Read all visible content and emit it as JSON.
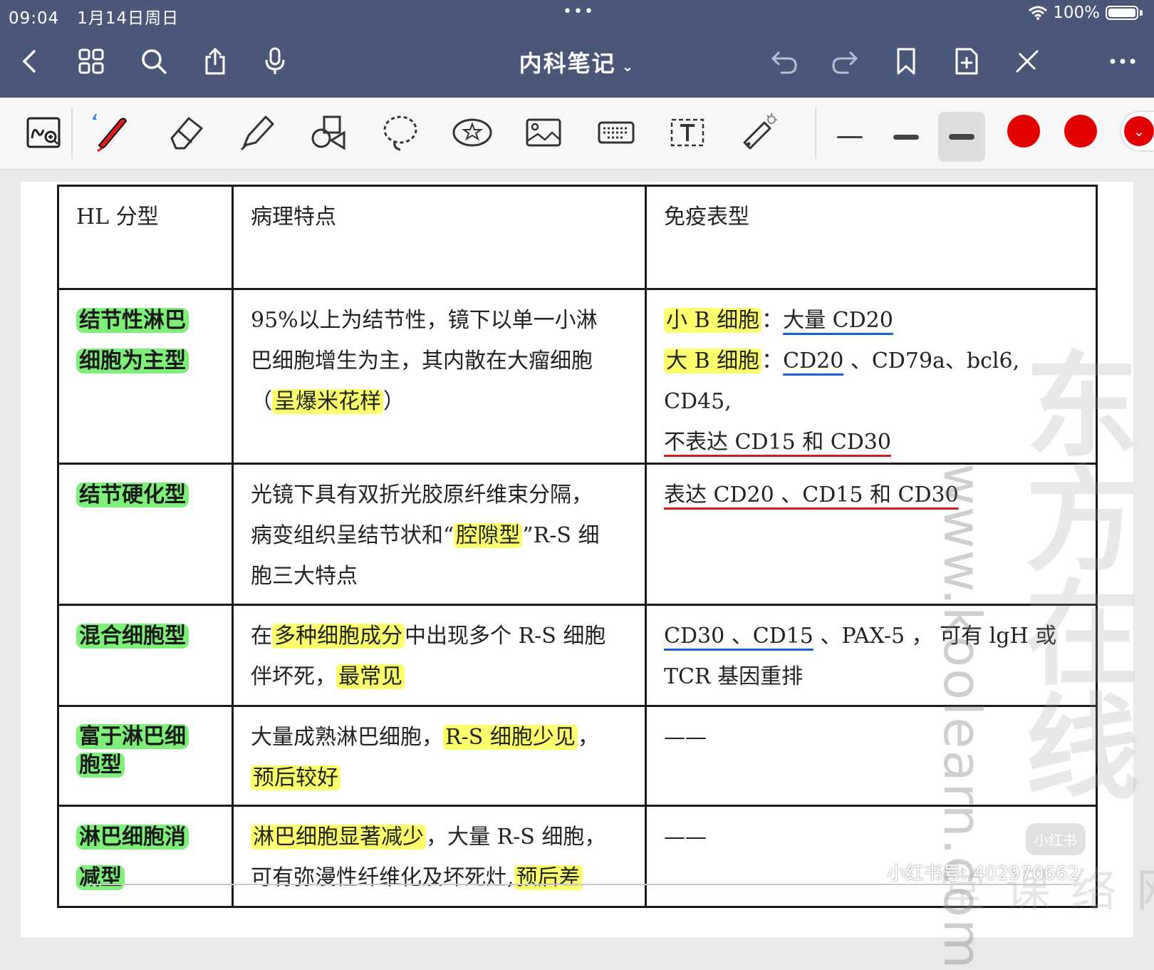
{
  "status": {
    "time": "09:04",
    "date": "1月14日周日",
    "battery": "100%"
  },
  "nav": {
    "title": "内科笔记",
    "caret": "⌄"
  },
  "toolbar": {
    "tools": [
      "zoom-write-icon",
      "pen-icon",
      "eraser-icon",
      "highlighter-icon",
      "shapes-icon",
      "lasso-icon",
      "sticker-icon",
      "image-icon",
      "keyboard-icon",
      "text-box-icon",
      "laser-pointer-icon"
    ],
    "color": "#e30000"
  },
  "table": {
    "headers": [
      "HL 分型",
      "病理特点",
      "免疫表型"
    ],
    "rows": [
      {
        "type_a": "结节性淋巴",
        "type_b": "细胞为主型",
        "path_1": "95%以上为结节性，镜下以单一小淋",
        "path_2": "巴细胞增生为主，其内散在大瘤细胞",
        "path_3_pre": "（",
        "path_3_hl": "呈爆米花样",
        "path_3_post": "）",
        "imm_1_hl": "小 B 细胞",
        "imm_1_colon": "：",
        "imm_1_ul": "大量 CD20",
        "imm_2_hl": "大 B 细胞",
        "imm_2_colon": "：",
        "imm_2_ul": "CD20",
        "imm_2_rest": " 、CD79a、bcl6, CD45,",
        "imm_3_ul": "不表达 CD15 和 CD30"
      },
      {
        "type_a": "结节硬化型",
        "path_1": "光镜下具有双折光胶原纤维束分隔，",
        "path_2_pre": "病变组织呈结节状和“",
        "path_2_hl": "腔隙型",
        "path_2_post": "”R-S 细",
        "path_3": "胞三大特点",
        "imm_1_ul": "表达 CD20 、CD15 和 CD30"
      },
      {
        "type_a": "混合细胞型",
        "path_1_pre": "在",
        "path_1_hl": "多种细胞成分",
        "path_1_post": "中出现多个 R-S 细胞",
        "path_2_pre": "伴坏死，",
        "path_2_hl": "最常见",
        "imm_1_ul": "CD30 、CD15",
        "imm_1_rest": " 、PAX-5 ， 可有 lgH 或",
        "imm_2": "TCR 基因重排"
      },
      {
        "type_a": "富于淋巴细",
        "type_b": "胞型",
        "path_1_pre": "大量成熟淋巴细胞，",
        "path_1_hl": "R-S 细胞少见",
        "path_1_post": "，",
        "path_2_hl": "预后较好",
        "imm_1": "——"
      },
      {
        "type_a": "淋巴细胞消",
        "type_b": "减型",
        "path_1_hl": "淋巴细胞显著减少",
        "path_1_post": "，大量 R-S 细胞，",
        "path_2_pre": "可有弥漫性纤维化及坏死灶,",
        "path_2_hl": "预后差",
        "imm_1": "——"
      }
    ]
  },
  "watermarks": {
    "site": "www.koolearn.com",
    "big": "东方在线",
    "small": "网络课堂",
    "xhs_logo": "小红书",
    "xhs_id": "小红书号: 402970662"
  }
}
